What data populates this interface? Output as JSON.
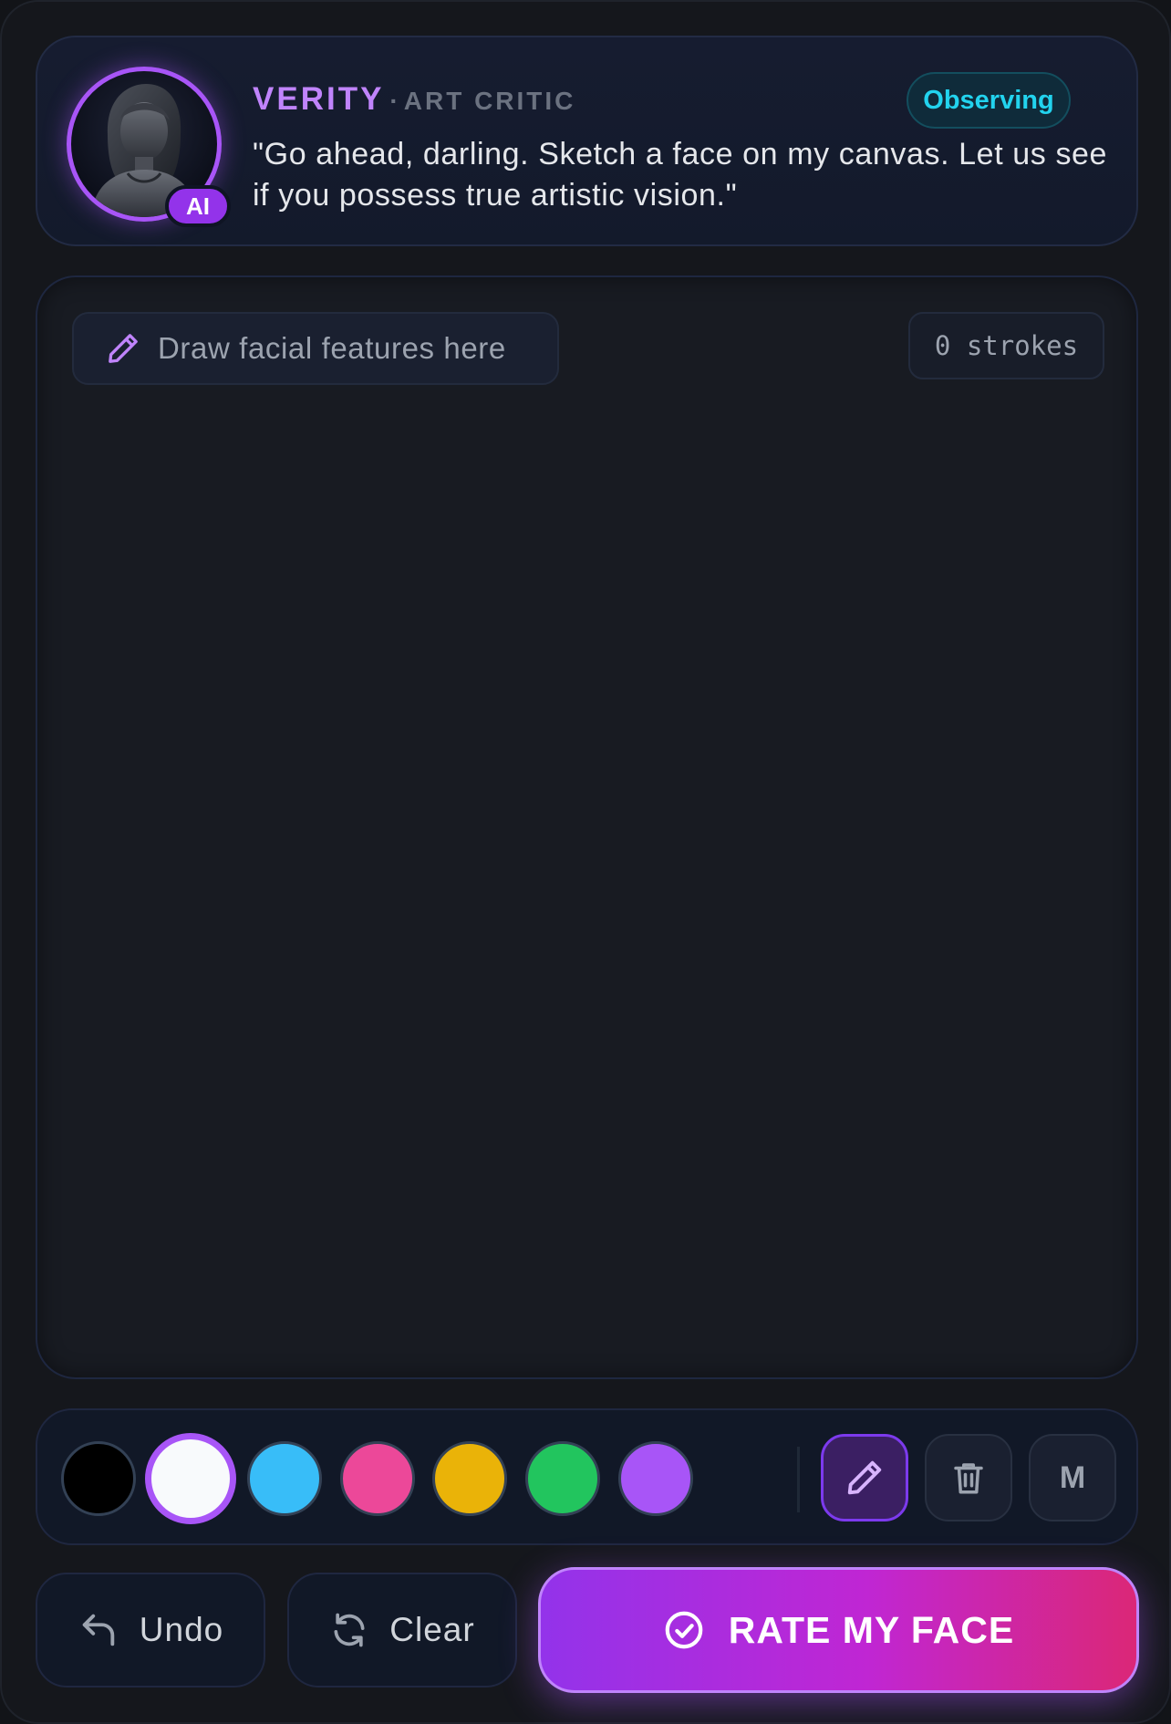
{
  "persona": {
    "name": "VERITY",
    "separator": "·",
    "role": "ART CRITIC",
    "ai_badge": "AI",
    "status": "Observing",
    "quote": "\"Go ahead, darling. Sketch a face on my canvas. Let us see if you possess true artistic vision.\""
  },
  "canvas": {
    "hint": "Draw facial features here",
    "stroke_count": "0 strokes"
  },
  "palette": {
    "colors": [
      "#000000",
      "#f8fafc",
      "#38bdf8",
      "#ec4899",
      "#eab308",
      "#22c55e",
      "#a855f7"
    ],
    "selected_color": "#f8fafc",
    "accent": "#a855f7"
  },
  "tools": {
    "pen_icon": "pencil-icon",
    "eraser_icon": "trash-icon",
    "size_label": "M"
  },
  "actions": {
    "undo_label": "Undo",
    "clear_label": "Clear",
    "rate_label": "RATE MY FACE"
  }
}
